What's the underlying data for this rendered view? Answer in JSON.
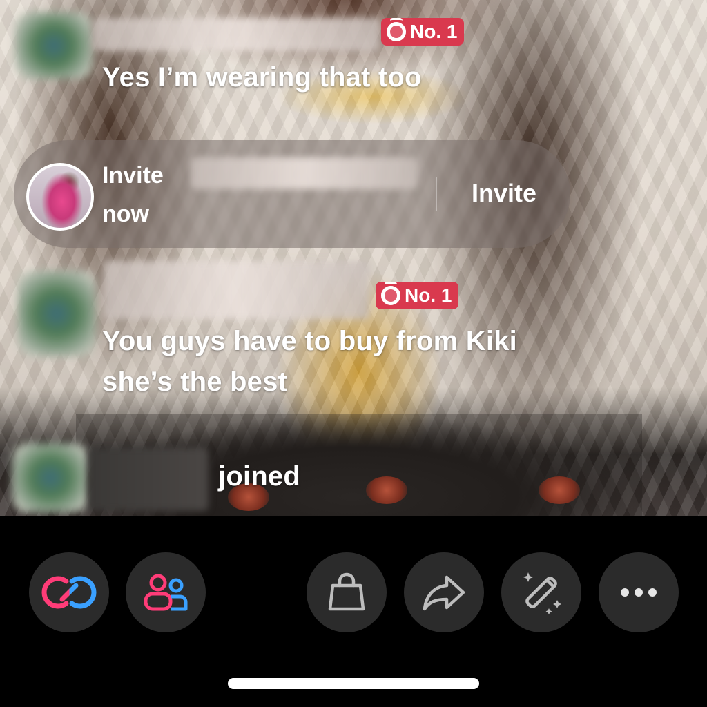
{
  "comments": [
    {
      "text": "Yes I’m wearing that too",
      "badge": "No. 1"
    },
    {
      "text_line1": "You guys have to buy from Kiki",
      "text_line2": "she’s the best",
      "badge": "No. 1"
    }
  ],
  "invite": {
    "prompt_line1": "Invite",
    "prompt_line2": "now",
    "button_label": "Invite"
  },
  "join_event": {
    "text": "joined"
  },
  "toolbar": {
    "items": [
      {
        "icon": "link-icon"
      },
      {
        "icon": "people-icon"
      },
      {
        "icon": "shopping-bag-icon"
      },
      {
        "icon": "share-arrow-icon"
      },
      {
        "icon": "magic-wand-icon"
      },
      {
        "icon": "more-icon"
      }
    ]
  },
  "colors": {
    "badge": "#d9394e",
    "toolbar_button": "#2b2b2b",
    "gradient_pink": "#ff3c78",
    "gradient_blue": "#3aa0ff"
  }
}
